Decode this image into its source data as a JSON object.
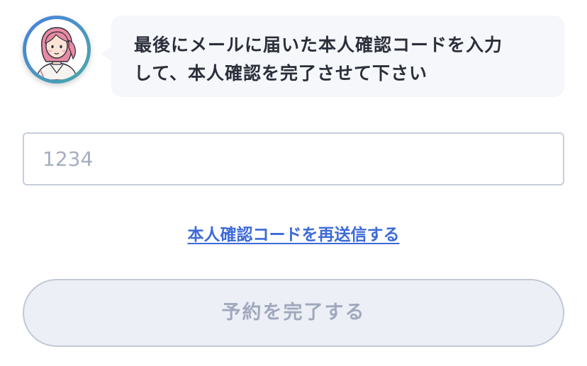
{
  "assistant": {
    "avatar_icon": "assistant-avatar-icon",
    "message": "最後にメールに届いた本人確認コードを入力\nして、本人確認を完了させて下さい"
  },
  "form": {
    "code_placeholder": "1234",
    "code_value": "",
    "resend_link_label": "本人確認コードを再送信する",
    "submit_label": "予約を完了する",
    "submit_enabled": false
  },
  "colors": {
    "link": "#3d6ad8",
    "avatar_ring_start": "#4a7fe0",
    "avatar_ring_end": "#49a9a6",
    "bubble_bg": "#f5f7fb",
    "button_disabled_bg": "#eceff6",
    "button_disabled_text": "#a0a8bc"
  }
}
